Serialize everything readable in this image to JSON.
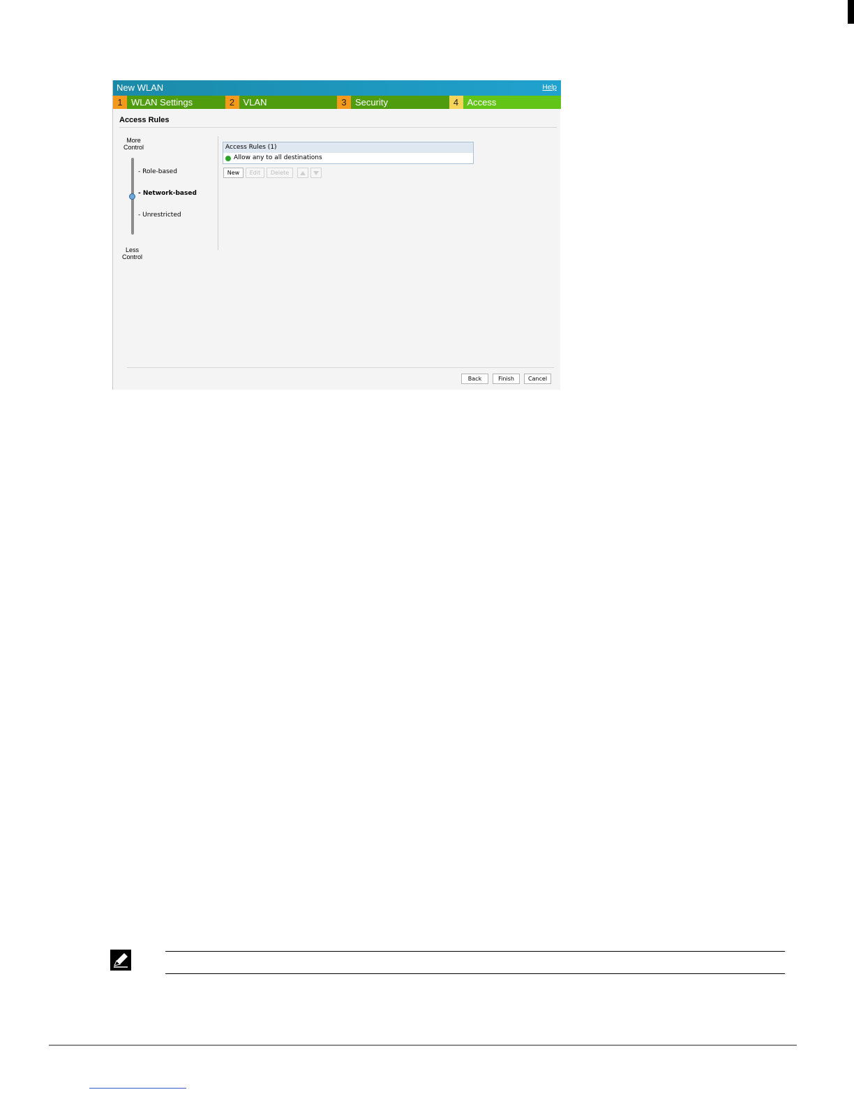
{
  "wizard": {
    "title": "New WLAN",
    "help": "Help",
    "steps": [
      {
        "num": "1",
        "label": "WLAN Settings"
      },
      {
        "num": "2",
        "label": "VLAN"
      },
      {
        "num": "3",
        "label": "Security"
      },
      {
        "num": "4",
        "label": "Access"
      }
    ],
    "active_step": 4,
    "section_title": "Access Rules",
    "slider": {
      "more": "More\nControl",
      "less": "Less\nControl",
      "levels": [
        "- Role-based",
        "- Network-based",
        "- Unrestricted"
      ],
      "selected": "- Network-based"
    },
    "rules": {
      "header": "Access Rules (1)",
      "rows": [
        "Allow any to all destinations"
      ],
      "status_color": "#2aa52a"
    },
    "buttons": {
      "new": "New",
      "edit": "Edit",
      "delete": "Delete"
    },
    "footer": {
      "back": "Back",
      "finish": "Finish",
      "cancel": "Cancel"
    }
  },
  "colors": {
    "title_bar": "#1b8aa8",
    "step_bg": "#4f9d0f",
    "step_active_bg": "#62c416",
    "step_num": "#f39a1c"
  },
  "icons": {
    "note": "pencil-note-icon"
  }
}
